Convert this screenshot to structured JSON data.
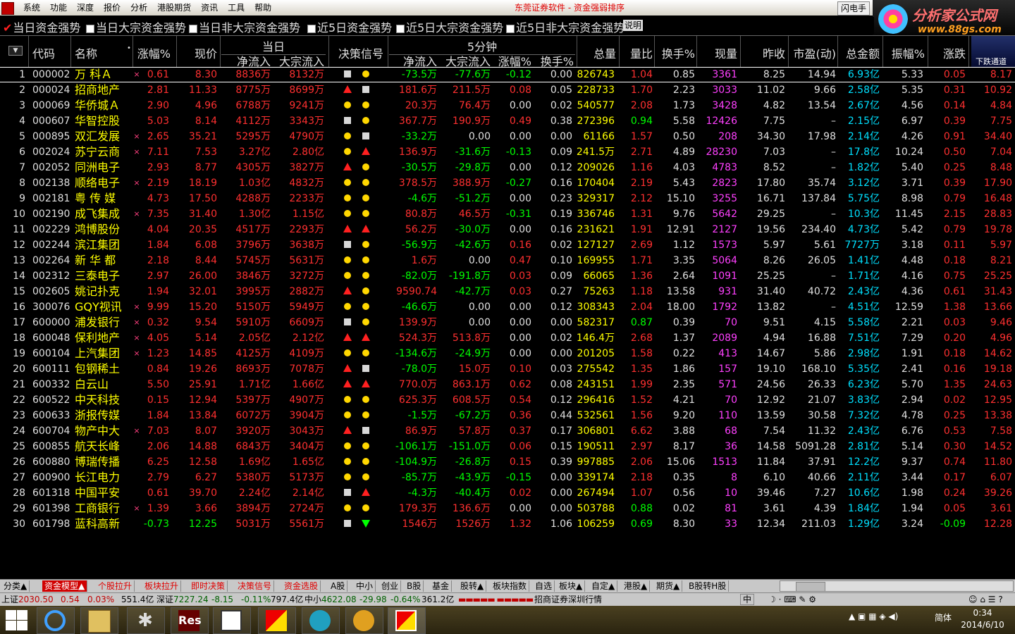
{
  "menu": {
    "items": [
      "系统",
      "功能",
      "深度",
      "报价",
      "分析",
      "港股期货",
      "资讯",
      "工具",
      "帮助"
    ],
    "title": "东莞证券软件 - 资金强弱排序",
    "flash": "闪电手"
  },
  "brand": {
    "name": "分析家公式网",
    "url": "www.88gs.com"
  },
  "filters": [
    {
      "label": "当日资金强势",
      "checked": true
    },
    {
      "label": "当日大宗资金强势",
      "checked": false
    },
    {
      "label": "当日非大宗资金强势",
      "checked": false
    },
    {
      "label": "近5日资金强势",
      "checked": false
    },
    {
      "label": "近5日大宗资金强势",
      "checked": false
    },
    {
      "label": "近5日非大宗资金强势",
      "checked": false
    }
  ],
  "explain_label": "说明",
  "header": {
    "code": "代码",
    "name": "名称",
    "chg": "涨幅%",
    "price": "现价",
    "day_group": "当日",
    "net": "净流入",
    "block": "大宗流入",
    "signal": "决策信号",
    "min5_group": "5分钟",
    "net5": "净流入",
    "block5": "大宗流入",
    "chg5": "涨幅%",
    "turn5": "换手%",
    "vol": "总量",
    "ratio": "量比",
    "turn": "换手%",
    "cur": "现量",
    "prev": "昨收",
    "pe": "市盈(动)",
    "amount": "总金额",
    "amp": "振幅%",
    "diff": "涨跌",
    "down_channel": "下跌通道"
  },
  "rows": [
    {
      "i": "1",
      "code": "000002",
      "name": "万  科Ａ",
      "mark": "×",
      "chg": "0.61",
      "price": "8.30",
      "net": "8836万",
      "block": "8132万",
      "s1": "square",
      "s2": "circle",
      "n5": "-73.5万",
      "b5": "-77.6万",
      "c5": "-0.12",
      "t5": "0.00",
      "vol": "826743",
      "ratio": "1.04",
      "turn": "0.85",
      "cur": "3361",
      "prev": "8.25",
      "pe": "14.94",
      "amt": "6.93亿",
      "amp": "5.33",
      "diff": "0.05",
      "last": "8.17"
    },
    {
      "i": "2",
      "code": "000024",
      "name": "招商地产",
      "mark": "",
      "chg": "2.81",
      "price": "11.33",
      "net": "8775万",
      "block": "8699万",
      "s1": "up",
      "s2": "square",
      "n5": "181.6万",
      "b5": "211.5万",
      "c5": "0.08",
      "t5": "0.05",
      "vol": "228733",
      "ratio": "1.70",
      "turn": "2.23",
      "cur": "3033",
      "prev": "11.02",
      "pe": "9.66",
      "amt": "2.58亿",
      "amp": "5.35",
      "diff": "0.31",
      "last": "10.92"
    },
    {
      "i": "3",
      "code": "000069",
      "name": "华侨城Ａ",
      "mark": "",
      "chg": "2.90",
      "price": "4.96",
      "net": "6788万",
      "block": "9241万",
      "s1": "circle",
      "s2": "circle",
      "n5": "20.3万",
      "b5": "76.4万",
      "c5": "0.00",
      "t5": "0.02",
      "vol": "540577",
      "ratio": "2.08",
      "turn": "1.73",
      "cur": "3428",
      "prev": "4.82",
      "pe": "13.54",
      "amt": "2.67亿",
      "amp": "4.56",
      "diff": "0.14",
      "last": "4.84"
    },
    {
      "i": "4",
      "code": "000607",
      "name": "华智控股",
      "mark": "",
      "chg": "5.03",
      "price": "8.14",
      "net": "4112万",
      "block": "3343万",
      "s1": "square",
      "s2": "circle",
      "n5": "367.7万",
      "b5": "190.9万",
      "c5": "0.49",
      "t5": "0.38",
      "vol": "272396",
      "ratio": "0.94",
      "turn": "5.58",
      "cur": "12426",
      "prev": "7.75",
      "pe": "–",
      "amt": "2.15亿",
      "amp": "6.97",
      "diff": "0.39",
      "last": "7.75"
    },
    {
      "i": "5",
      "code": "000895",
      "name": "双汇发展",
      "mark": "×",
      "chg": "2.65",
      "price": "35.21",
      "net": "5295万",
      "block": "4790万",
      "s1": "circle",
      "s2": "square",
      "n5": "-33.2万",
      "b5": "0.00",
      "c5": "0.00",
      "t5": "0.00",
      "vol": "61166",
      "ratio": "1.57",
      "turn": "0.50",
      "cur": "208",
      "prev": "34.30",
      "pe": "17.98",
      "amt": "2.14亿",
      "amp": "4.26",
      "diff": "0.91",
      "last": "34.40"
    },
    {
      "i": "6",
      "code": "002024",
      "name": "苏宁云商",
      "mark": "×",
      "chg": "7.11",
      "price": "7.53",
      "net": "3.27亿",
      "block": "2.80亿",
      "s1": "circle",
      "s2": "up",
      "n5": "136.9万",
      "b5": "-31.6万",
      "c5": "-0.13",
      "t5": "0.09",
      "vol": "241.5万",
      "ratio": "2.71",
      "turn": "4.89",
      "cur": "28230",
      "prev": "7.03",
      "pe": "–",
      "amt": "17.8亿",
      "amp": "10.24",
      "diff": "0.50",
      "last": "7.04"
    },
    {
      "i": "7",
      "code": "002052",
      "name": "同洲电子",
      "mark": "",
      "chg": "2.93",
      "price": "8.77",
      "net": "4305万",
      "block": "3827万",
      "s1": "up",
      "s2": "circle",
      "n5": "-30.5万",
      "b5": "-29.8万",
      "c5": "0.00",
      "t5": "0.12",
      "vol": "209026",
      "ratio": "1.16",
      "turn": "4.03",
      "cur": "4783",
      "prev": "8.52",
      "pe": "–",
      "amt": "1.82亿",
      "amp": "5.40",
      "diff": "0.25",
      "last": "8.48"
    },
    {
      "i": "8",
      "code": "002138",
      "name": "顺络电子",
      "mark": "×",
      "chg": "2.19",
      "price": "18.19",
      "net": "1.03亿",
      "block": "4832万",
      "s1": "circle",
      "s2": "circle",
      "n5": "378.5万",
      "b5": "388.9万",
      "c5": "-0.27",
      "t5": "0.16",
      "vol": "170404",
      "ratio": "2.19",
      "turn": "5.43",
      "cur": "2823",
      "prev": "17.80",
      "pe": "35.74",
      "amt": "3.12亿",
      "amp": "3.71",
      "diff": "0.39",
      "last": "17.90"
    },
    {
      "i": "9",
      "code": "002181",
      "name": "粤 传 媒",
      "mark": "",
      "chg": "4.73",
      "price": "17.50",
      "net": "4288万",
      "block": "2233万",
      "s1": "circle",
      "s2": "circle",
      "n5": "-4.6万",
      "b5": "-51.2万",
      "c5": "0.00",
      "t5": "0.23",
      "vol": "329317",
      "ratio": "2.12",
      "turn": "15.10",
      "cur": "3255",
      "prev": "16.71",
      "pe": "137.84",
      "amt": "5.75亿",
      "amp": "8.98",
      "diff": "0.79",
      "last": "16.48"
    },
    {
      "i": "10",
      "code": "002190",
      "name": "成飞集成",
      "mark": "×",
      "chg": "7.35",
      "price": "31.40",
      "net": "1.30亿",
      "block": "1.15亿",
      "s1": "circle",
      "s2": "circle",
      "n5": "80.8万",
      "b5": "46.5万",
      "c5": "-0.31",
      "t5": "0.19",
      "vol": "336746",
      "ratio": "1.31",
      "turn": "9.76",
      "cur": "5642",
      "prev": "29.25",
      "pe": "–",
      "amt": "10.3亿",
      "amp": "11.45",
      "diff": "2.15",
      "last": "28.83"
    },
    {
      "i": "11",
      "code": "002229",
      "name": "鸿博股份",
      "mark": "",
      "chg": "4.04",
      "price": "20.35",
      "net": "4517万",
      "block": "2293万",
      "s1": "up",
      "s2": "up",
      "n5": "56.2万",
      "b5": "-30.0万",
      "c5": "0.00",
      "t5": "0.16",
      "vol": "231621",
      "ratio": "1.91",
      "turn": "12.91",
      "cur": "2127",
      "prev": "19.56",
      "pe": "234.40",
      "amt": "4.73亿",
      "amp": "5.42",
      "diff": "0.79",
      "last": "19.78"
    },
    {
      "i": "12",
      "code": "002244",
      "name": "滨江集团",
      "mark": "",
      "chg": "1.84",
      "price": "6.08",
      "net": "3796万",
      "block": "3638万",
      "s1": "square",
      "s2": "circle",
      "n5": "-56.9万",
      "b5": "-42.6万",
      "c5": "0.16",
      "t5": "0.02",
      "vol": "127127",
      "ratio": "2.69",
      "turn": "1.12",
      "cur": "1573",
      "prev": "5.97",
      "pe": "5.61",
      "amt": "7727万",
      "amp": "3.18",
      "diff": "0.11",
      "last": "5.97"
    },
    {
      "i": "13",
      "code": "002264",
      "name": "新 华 都",
      "mark": "",
      "chg": "2.18",
      "price": "8.44",
      "net": "5745万",
      "block": "5631万",
      "s1": "circle",
      "s2": "circle",
      "n5": "1.6万",
      "b5": "0.00",
      "c5": "0.47",
      "t5": "0.10",
      "vol": "169955",
      "ratio": "1.71",
      "turn": "3.35",
      "cur": "5064",
      "prev": "8.26",
      "pe": "26.05",
      "amt": "1.41亿",
      "amp": "4.48",
      "diff": "0.18",
      "last": "8.21"
    },
    {
      "i": "14",
      "code": "002312",
      "name": "三泰电子",
      "mark": "",
      "chg": "2.97",
      "price": "26.00",
      "net": "3846万",
      "block": "3272万",
      "s1": "circle",
      "s2": "circle",
      "n5": "-82.0万",
      "b5": "-191.8万",
      "c5": "0.03",
      "t5": "0.09",
      "vol": "66065",
      "ratio": "1.36",
      "turn": "2.64",
      "cur": "1091",
      "prev": "25.25",
      "pe": "–",
      "amt": "1.71亿",
      "amp": "4.16",
      "diff": "0.75",
      "last": "25.25"
    },
    {
      "i": "15",
      "code": "002605",
      "name": "姚记扑克",
      "mark": "",
      "chg": "1.94",
      "price": "32.01",
      "net": "3995万",
      "block": "2882万",
      "s1": "up",
      "s2": "circle",
      "n5": "9590.74",
      "b5": "-42.7万",
      "c5": "0.03",
      "t5": "0.27",
      "vol": "75263",
      "ratio": "1.18",
      "turn": "13.58",
      "cur": "931",
      "prev": "31.40",
      "pe": "40.72",
      "amt": "2.43亿",
      "amp": "4.36",
      "diff": "0.61",
      "last": "31.43"
    },
    {
      "i": "16",
      "code": "300076",
      "name": "GQY视讯",
      "mark": "×",
      "chg": "9.99",
      "price": "15.20",
      "net": "5150万",
      "block": "5949万",
      "s1": "circle",
      "s2": "circle",
      "n5": "-46.6万",
      "b5": "0.00",
      "c5": "0.00",
      "t5": "0.12",
      "vol": "308343",
      "ratio": "2.04",
      "turn": "18.00",
      "cur": "1792",
      "prev": "13.82",
      "pe": "–",
      "amt": "4.51亿",
      "amp": "12.59",
      "diff": "1.38",
      "last": "13.66"
    },
    {
      "i": "17",
      "code": "600000",
      "name": "浦发银行",
      "mark": "×",
      "chg": "0.32",
      "price": "9.54",
      "net": "5910万",
      "block": "6609万",
      "s1": "square",
      "s2": "circle",
      "n5": "139.9万",
      "b5": "0.00",
      "c5": "0.00",
      "t5": "0.00",
      "vol": "582317",
      "ratio": "0.87",
      "turn": "0.39",
      "cur": "70",
      "prev": "9.51",
      "pe": "4.15",
      "amt": "5.58亿",
      "amp": "2.21",
      "diff": "0.03",
      "last": "9.46"
    },
    {
      "i": "18",
      "code": "600048",
      "name": "保利地产",
      "mark": "×",
      "chg": "4.05",
      "price": "5.14",
      "net": "2.05亿",
      "block": "2.12亿",
      "s1": "up",
      "s2": "up",
      "n5": "524.3万",
      "b5": "513.8万",
      "c5": "0.00",
      "t5": "0.02",
      "vol": "146.4万",
      "ratio": "2.68",
      "turn": "1.37",
      "cur": "2089",
      "prev": "4.94",
      "pe": "16.88",
      "amt": "7.51亿",
      "amp": "7.29",
      "diff": "0.20",
      "last": "4.96"
    },
    {
      "i": "19",
      "code": "600104",
      "name": "上汽集团",
      "mark": "×",
      "chg": "1.23",
      "price": "14.85",
      "net": "4125万",
      "block": "4109万",
      "s1": "circle",
      "s2": "circle",
      "n5": "-134.6万",
      "b5": "-24.9万",
      "c5": "0.00",
      "t5": "0.00",
      "vol": "201205",
      "ratio": "1.58",
      "turn": "0.22",
      "cur": "413",
      "prev": "14.67",
      "pe": "5.86",
      "amt": "2.98亿",
      "amp": "1.91",
      "diff": "0.18",
      "last": "14.62"
    },
    {
      "i": "20",
      "code": "600111",
      "name": "包钢稀土",
      "mark": "",
      "chg": "0.84",
      "price": "19.26",
      "net": "8693万",
      "block": "7078万",
      "s1": "up",
      "s2": "square",
      "n5": "-78.0万",
      "b5": "15.0万",
      "c5": "0.10",
      "t5": "0.03",
      "vol": "275542",
      "ratio": "1.35",
      "turn": "1.86",
      "cur": "157",
      "prev": "19.10",
      "pe": "168.10",
      "amt": "5.35亿",
      "amp": "2.41",
      "diff": "0.16",
      "last": "19.18"
    },
    {
      "i": "21",
      "code": "600332",
      "name": "白云山",
      "mark": "",
      "chg": "5.50",
      "price": "25.91",
      "net": "1.71亿",
      "block": "1.66亿",
      "s1": "up",
      "s2": "up",
      "n5": "770.0万",
      "b5": "863.1万",
      "c5": "0.62",
      "t5": "0.08",
      "vol": "243151",
      "ratio": "1.99",
      "turn": "2.35",
      "cur": "571",
      "prev": "24.56",
      "pe": "26.33",
      "amt": "6.23亿",
      "amp": "5.70",
      "diff": "1.35",
      "last": "24.63"
    },
    {
      "i": "22",
      "code": "600522",
      "name": "中天科技",
      "mark": "",
      "chg": "0.15",
      "price": "12.94",
      "net": "5397万",
      "block": "4907万",
      "s1": "circle",
      "s2": "circle",
      "n5": "625.3万",
      "b5": "608.5万",
      "c5": "0.54",
      "t5": "0.12",
      "vol": "296416",
      "ratio": "1.52",
      "turn": "4.21",
      "cur": "70",
      "prev": "12.92",
      "pe": "21.07",
      "amt": "3.83亿",
      "amp": "2.94",
      "diff": "0.02",
      "last": "12.95"
    },
    {
      "i": "23",
      "code": "600633",
      "name": "浙报传媒",
      "mark": "",
      "chg": "1.84",
      "price": "13.84",
      "net": "6072万",
      "block": "3904万",
      "s1": "circle",
      "s2": "circle",
      "n5": "-1.5万",
      "b5": "-67.2万",
      "c5": "0.36",
      "t5": "0.44",
      "vol": "532561",
      "ratio": "1.56",
      "turn": "9.20",
      "cur": "110",
      "prev": "13.59",
      "pe": "30.58",
      "amt": "7.32亿",
      "amp": "4.78",
      "diff": "0.25",
      "last": "13.38"
    },
    {
      "i": "24",
      "code": "600704",
      "name": "物产中大",
      "mark": "×",
      "chg": "7.03",
      "price": "8.07",
      "net": "3920万",
      "block": "3043万",
      "s1": "up",
      "s2": "square",
      "n5": "86.9万",
      "b5": "57.8万",
      "c5": "0.37",
      "t5": "0.17",
      "vol": "306801",
      "ratio": "6.62",
      "turn": "3.88",
      "cur": "68",
      "prev": "7.54",
      "pe": "11.32",
      "amt": "2.43亿",
      "amp": "6.76",
      "diff": "0.53",
      "last": "7.58"
    },
    {
      "i": "25",
      "code": "600855",
      "name": "航天长峰",
      "mark": "",
      "chg": "2.06",
      "price": "14.88",
      "net": "6843万",
      "block": "3404万",
      "s1": "circle",
      "s2": "circle",
      "n5": "-106.1万",
      "b5": "-151.0万",
      "c5": "0.06",
      "t5": "0.15",
      "vol": "190511",
      "ratio": "2.97",
      "turn": "8.17",
      "cur": "36",
      "prev": "14.58",
      "pe": "5091.28",
      "amt": "2.81亿",
      "amp": "5.14",
      "diff": "0.30",
      "last": "14.52"
    },
    {
      "i": "26",
      "code": "600880",
      "name": "博瑞传播",
      "mark": "",
      "chg": "6.25",
      "price": "12.58",
      "net": "1.69亿",
      "block": "1.65亿",
      "s1": "circle",
      "s2": "circle",
      "n5": "-104.9万",
      "b5": "-26.8万",
      "c5": "0.15",
      "t5": "0.39",
      "vol": "997885",
      "ratio": "2.06",
      "turn": "15.06",
      "cur": "1513",
      "prev": "11.84",
      "pe": "37.91",
      "amt": "12.2亿",
      "amp": "9.37",
      "diff": "0.74",
      "last": "11.80"
    },
    {
      "i": "27",
      "code": "600900",
      "name": "长江电力",
      "mark": "",
      "chg": "2.79",
      "price": "6.27",
      "net": "5380万",
      "block": "5173万",
      "s1": "circle",
      "s2": "circle",
      "n5": "-85.7万",
      "b5": "-43.9万",
      "c5": "-0.15",
      "t5": "0.00",
      "vol": "339174",
      "ratio": "2.18",
      "turn": "0.35",
      "cur": "8",
      "prev": "6.10",
      "pe": "40.66",
      "amt": "2.11亿",
      "amp": "3.44",
      "diff": "0.17",
      "last": "6.07"
    },
    {
      "i": "28",
      "code": "601318",
      "name": "中国平安",
      "mark": "",
      "chg": "0.61",
      "price": "39.70",
      "net": "2.24亿",
      "block": "2.14亿",
      "s1": "square",
      "s2": "up",
      "n5": "-4.3万",
      "b5": "-40.4万",
      "c5": "0.02",
      "t5": "0.00",
      "vol": "267494",
      "ratio": "1.07",
      "turn": "0.56",
      "cur": "10",
      "prev": "39.46",
      "pe": "7.27",
      "amt": "10.6亿",
      "amp": "1.98",
      "diff": "0.24",
      "last": "39.26"
    },
    {
      "i": "29",
      "code": "601398",
      "name": "工商银行",
      "mark": "×",
      "chg": "1.39",
      "price": "3.66",
      "net": "3894万",
      "block": "2724万",
      "s1": "circle",
      "s2": "circle",
      "n5": "179.3万",
      "b5": "136.6万",
      "c5": "0.00",
      "t5": "0.00",
      "vol": "503788",
      "ratio": "0.88",
      "turn": "0.02",
      "cur": "81",
      "prev": "3.61",
      "pe": "4.39",
      "amt": "1.84亿",
      "amp": "1.94",
      "diff": "0.05",
      "last": "3.61"
    },
    {
      "i": "30",
      "code": "601798",
      "name": "蓝科高新",
      "mark": "",
      "chg": "-0.73",
      "price": "12.25",
      "net": "5031万",
      "block": "5561万",
      "s1": "square",
      "s2": "down",
      "n5": "1546万",
      "b5": "1526万",
      "c5": "1.32",
      "t5": "1.06",
      "vol": "106259",
      "ratio": "0.69",
      "turn": "8.30",
      "cur": "33",
      "prev": "12.34",
      "pe": "211.03",
      "amt": "1.29亿",
      "amp": "3.24",
      "diff": "-0.09",
      "last": "12.28"
    }
  ],
  "tabs": [
    {
      "label": "分类▲",
      "style": "normal"
    },
    {
      "label": "资金模型▲",
      "style": "active"
    },
    {
      "label": "个股拉升",
      "style": "red"
    },
    {
      "label": "板块拉升",
      "style": "red"
    },
    {
      "label": "即时决策",
      "style": "red"
    },
    {
      "label": "决策信号",
      "style": "red"
    },
    {
      "label": "资金选股",
      "style": "red"
    },
    {
      "label": "A股",
      "style": "normal"
    },
    {
      "label": "中小",
      "style": "normal"
    },
    {
      "label": "创业",
      "style": "normal"
    },
    {
      "label": "B股",
      "style": "normal"
    },
    {
      "label": "基金",
      "style": "normal"
    },
    {
      "label": "股转▲",
      "style": "normal"
    },
    {
      "label": "板块指数",
      "style": "normal"
    },
    {
      "label": "自选",
      "style": "normal"
    },
    {
      "label": "板块▲",
      "style": "normal"
    },
    {
      "label": "自定▲",
      "style": "normal"
    },
    {
      "label": "港股▲",
      "style": "normal"
    },
    {
      "label": "期货▲",
      "style": "normal"
    },
    {
      "label": "B股转H股",
      "style": "normal"
    }
  ],
  "status": {
    "sh_label": "上证",
    "sh_val": "2030.50",
    "sh_chg": "0.54",
    "sh_pct": "0.03%",
    "sh_amt": "551.4亿",
    "sz_label": "深证",
    "sz_val": "7227.24",
    "sz_chg": "-8.15",
    "sz_pct": "-0.11%",
    "sz_amt": "797.4亿",
    "zx_label": "中小",
    "zx_val": "4622.08",
    "zx_chg": "-29.98",
    "zx_pct": "-0.64%",
    "zx_amt": "361.2亿",
    "broker": "招商证券深圳行情",
    "ime": "中"
  },
  "taskbar": {
    "res_label": "Res",
    "lang": "简体",
    "time": "0:34",
    "date": "2014/6/10"
  }
}
